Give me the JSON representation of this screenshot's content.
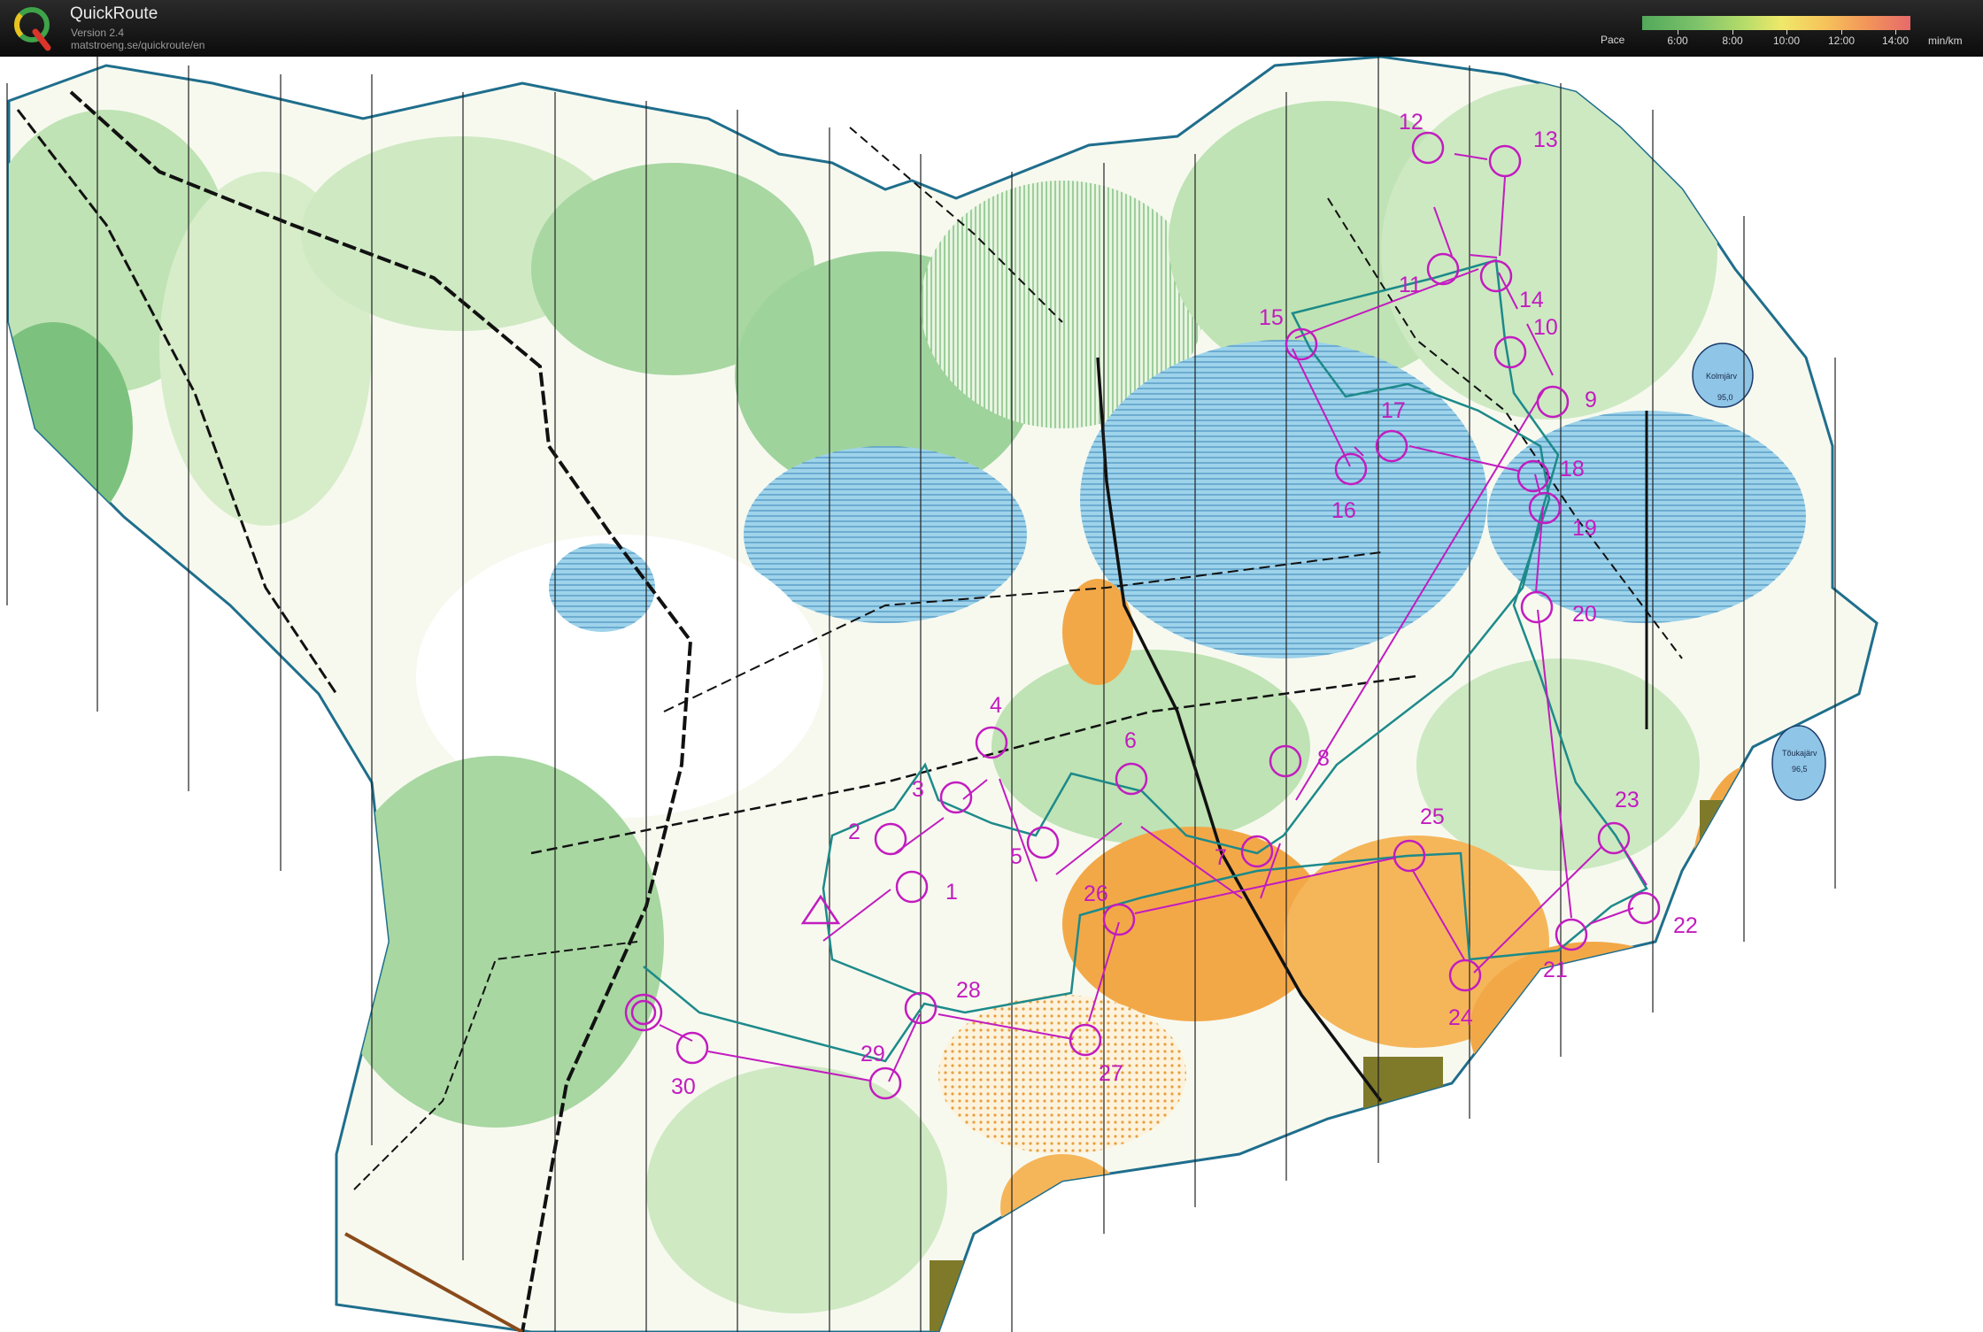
{
  "header": {
    "app_title": "QuickRoute",
    "version": "Version 2.4",
    "url": "matstroeng.se/quickroute/en",
    "logo_icon": "quickroute-q-logo-icon"
  },
  "pace_legend": {
    "label": "Pace",
    "unit": "min/km",
    "ticks": [
      "6:00",
      "8:00",
      "10:00",
      "12:00",
      "14:00"
    ],
    "colors": [
      "#52a85a",
      "#b6dc6a",
      "#efe86a",
      "#f6c35a",
      "#e66a6a"
    ]
  },
  "map": {
    "course_color": "#c21cbf",
    "route_color": "#1d8a8a",
    "controls": [
      {
        "label": "1"
      },
      {
        "label": "2"
      },
      {
        "label": "3"
      },
      {
        "label": "4"
      },
      {
        "label": "5"
      },
      {
        "label": "6"
      },
      {
        "label": "7"
      },
      {
        "label": "8"
      },
      {
        "label": "9"
      },
      {
        "label": "10"
      },
      {
        "label": "11"
      },
      {
        "label": "12"
      },
      {
        "label": "13"
      },
      {
        "label": "14"
      },
      {
        "label": "15"
      },
      {
        "label": "16"
      },
      {
        "label": "17"
      },
      {
        "label": "18"
      },
      {
        "label": "19"
      },
      {
        "label": "20"
      },
      {
        "label": "21"
      },
      {
        "label": "22"
      },
      {
        "label": "23"
      },
      {
        "label": "24"
      },
      {
        "label": "25"
      },
      {
        "label": "26"
      },
      {
        "label": "27"
      },
      {
        "label": "28"
      },
      {
        "label": "29"
      },
      {
        "label": "30"
      }
    ],
    "lakes": [
      {
        "name": "Kolmjärv",
        "height": "95,0"
      },
      {
        "name": "Tõukajärv",
        "height": "96,5"
      }
    ]
  }
}
